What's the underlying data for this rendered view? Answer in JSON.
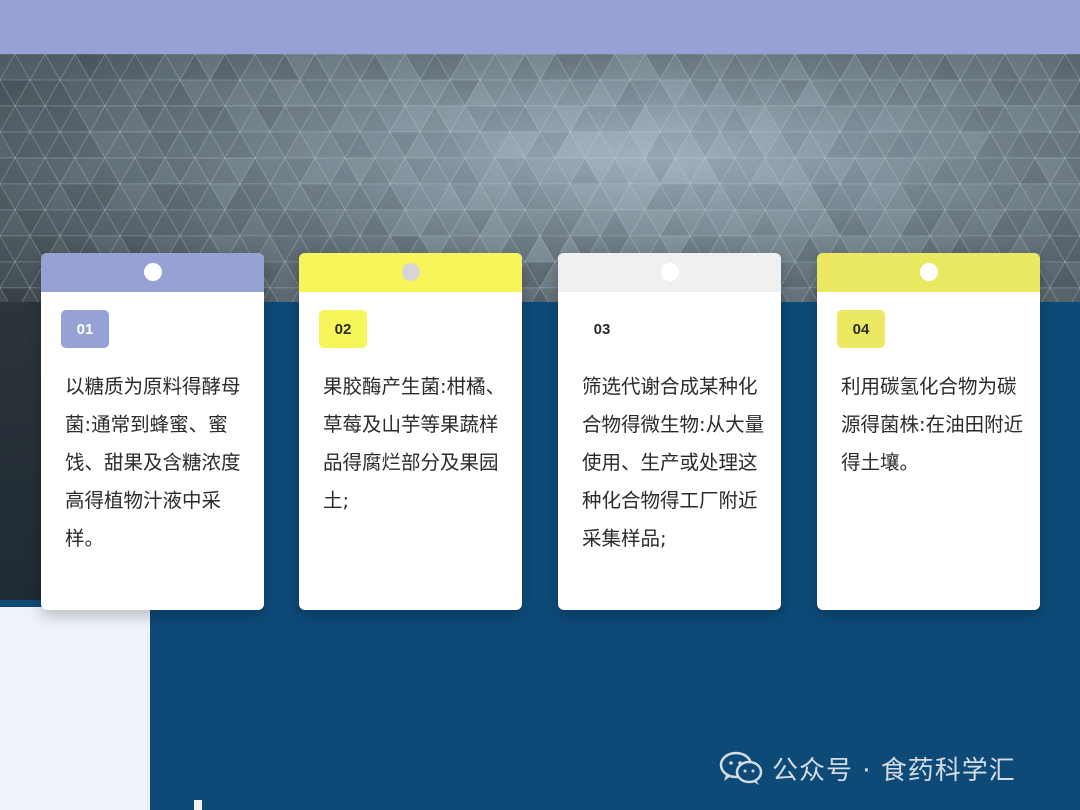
{
  "colors": {
    "top_band": "#95a2d3",
    "main_blue": "#0d4a78",
    "card_bg": "#ffffff"
  },
  "cards": [
    {
      "number": "01",
      "text": "以糖质为原料得酵母菌:通常到蜂蜜、蜜饯、甜果及含糖浓度高得植物汁液中采样。",
      "header_color": "#95a2d3",
      "dot_color": "#ffffff",
      "badge_bg": "#95a2d3",
      "badge_text_color": "#ffffff"
    },
    {
      "number": "02",
      "text": "果胶酶产生菌:柑橘、草莓及山芋等果蔬样品得腐烂部分及果园土;",
      "header_color": "#f6f65a",
      "dot_color": "#d6d6d6",
      "badge_bg": "#f6f65a",
      "badge_text_color": "#2b2b2b"
    },
    {
      "number": "03",
      "text": "筛选代谢合成某种化合物得微生物:从大量使用、生产或处理这种化合物得工厂附近采集样品;",
      "header_color": "#f0f0f0",
      "dot_color": "#ffffff",
      "badge_bg": "#ffffff",
      "badge_text_color": "#2b2b2b"
    },
    {
      "number": "04",
      "text": "利用碳氢化合物为碳源得菌株:在油田附近得土壤。",
      "header_color": "#ebe962",
      "dot_color": "#ffffff",
      "badge_bg": "#ebe962",
      "badge_text_color": "#2b2b2b"
    }
  ],
  "watermark": {
    "icon": "wechat-icon",
    "text": "公众号 · 食药科学汇"
  }
}
